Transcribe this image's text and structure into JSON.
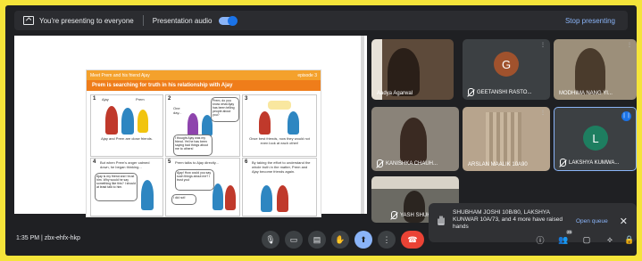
{
  "banner": {
    "presenting_text": "You're presenting to everyone",
    "audio_label": "Presentation audio",
    "stop_label": "Stop presenting"
  },
  "slide": {
    "header_left": "Meet Prem and his friend Ajay",
    "header_right": "episode 3",
    "title": "Prem is searching for truth in his relationship with Ajay",
    "panels": [
      {
        "num": "1",
        "label": "Ajay",
        "label2": "Prem",
        "caption": "Ajay and Prem are close friends."
      },
      {
        "num": "2",
        "text": "One day...",
        "bubble": "I thought Ajay was my friend. Yet he has been saying bad things about me to others!",
        "bubble2": "Prem, do you know what Ajay has been telling people about you?"
      },
      {
        "num": "3",
        "caption": "Once best friends, now they would not even look at each other!"
      },
      {
        "num": "4",
        "caption": "But when Prem's anger calmed down, he began thinking...",
        "bubble": "Ajay is my friend and I trust him. Why would he say something like this? I should at least talk to him."
      },
      {
        "num": "5",
        "caption": "Prem talks to Ajay directly...",
        "bubble": "Ajay! How could you say such things about me? I trust you!",
        "bubble2": "I did not!"
      },
      {
        "num": "6",
        "caption": "By taking the effort to understand the whole truth in the matter, Prem and Ajay become friends again."
      }
    ]
  },
  "participants": [
    {
      "name": "Aadya Agarwal",
      "type": "video"
    },
    {
      "name": "GEETANSHI RASTO...",
      "type": "avatar",
      "initial": "G",
      "color": "#a0522d"
    },
    {
      "name": "MODHIMA NANG YI...",
      "type": "video"
    },
    {
      "name": "KANISHKA CHAUH...",
      "type": "video"
    },
    {
      "name": "ARSLAN MAALIK 10&#8203;A90",
      "type": "video"
    },
    {
      "name": "LAKSHYA KUMWA...",
      "type": "avatar",
      "initial": "L",
      "color": "#1e7e60"
    },
    {
      "name": "YASH SHUKLA",
      "type": "video"
    }
  ],
  "toast": {
    "message": "SHUBHAM JOSHI 10B/80, LAKSHYA KUNWAR 10&#8203;A/73, and 4 more have raised hands",
    "action": "Open queue"
  },
  "bottom_bar": {
    "time": "1:35 PM",
    "meeting_code": "zbx-ehfx-hkp",
    "participant_count": "26"
  },
  "colors": {
    "accent": "#8ab4f8",
    "end_call": "#ea4335",
    "slide_orange": "#ef7d1a",
    "outer_border": "#f5e43a"
  }
}
